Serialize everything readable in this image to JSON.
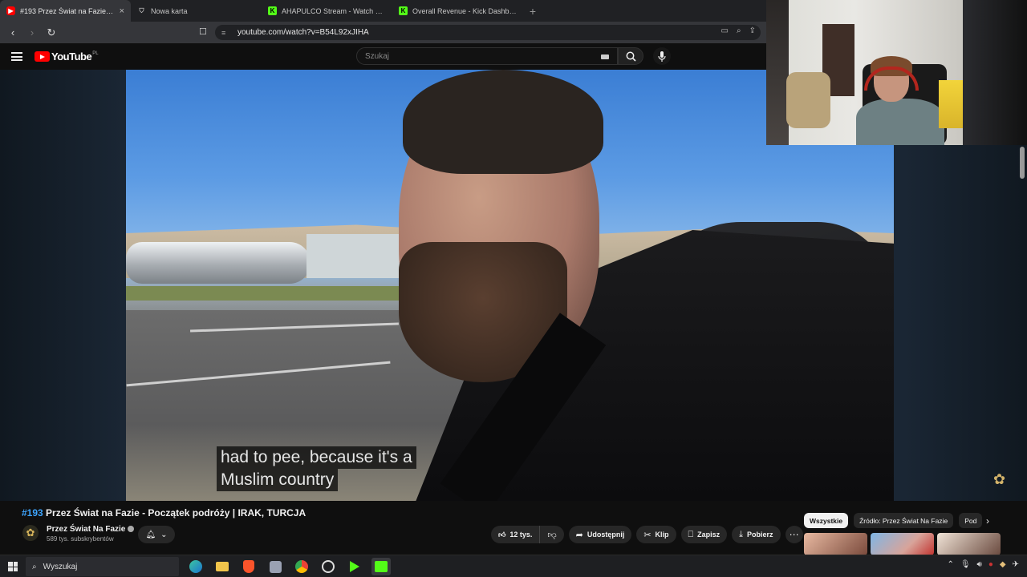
{
  "browser": {
    "tabs": [
      {
        "title": "#193 Przez Świat na Fazie - Począ",
        "active": true,
        "favicon": "youtube-icon",
        "close": "×"
      },
      {
        "title": "Nowa karta",
        "active": false,
        "favicon": "shield-icon"
      },
      {
        "title": "AHAPULCO Stream - Watch Live on K",
        "active": false,
        "favicon": "kick-icon"
      },
      {
        "title": "Overall Revenue - Kick Dashboard",
        "active": false,
        "favicon": "kick-icon"
      }
    ],
    "new_tab": "+",
    "url": "youtube.com/watch?v=B54L92xJIHA"
  },
  "youtube": {
    "logo_text": "YouTube",
    "country_code": "PL",
    "search_placeholder": "Szukaj"
  },
  "video": {
    "caption_line1": "had to pee, because it's a",
    "caption_line2": "Muslim country"
  },
  "info": {
    "title_hash": "#193",
    "title_rest": " Przez Świat na Fazie - Początek podróży | IRAK, TURCJA",
    "channel_name": "Przez Świat Na Fazie",
    "subscribers": "589 tys. subskrybentów",
    "likes": "12 tys.",
    "share_label": "Udostępnij",
    "clip_label": "Klip",
    "save_label": "Zapisz",
    "download_label": "Pobierz",
    "more_label": "⋯"
  },
  "chips": [
    "Wszystkie",
    "Źródło: Przez Świat Na Fazie",
    "Pod"
  ],
  "taskbar": {
    "search_label": "Wyszukaj"
  },
  "colors": {
    "youtube_red": "#ff0000",
    "kick_green": "#53fc18",
    "link_blue": "#3ea6ff"
  }
}
